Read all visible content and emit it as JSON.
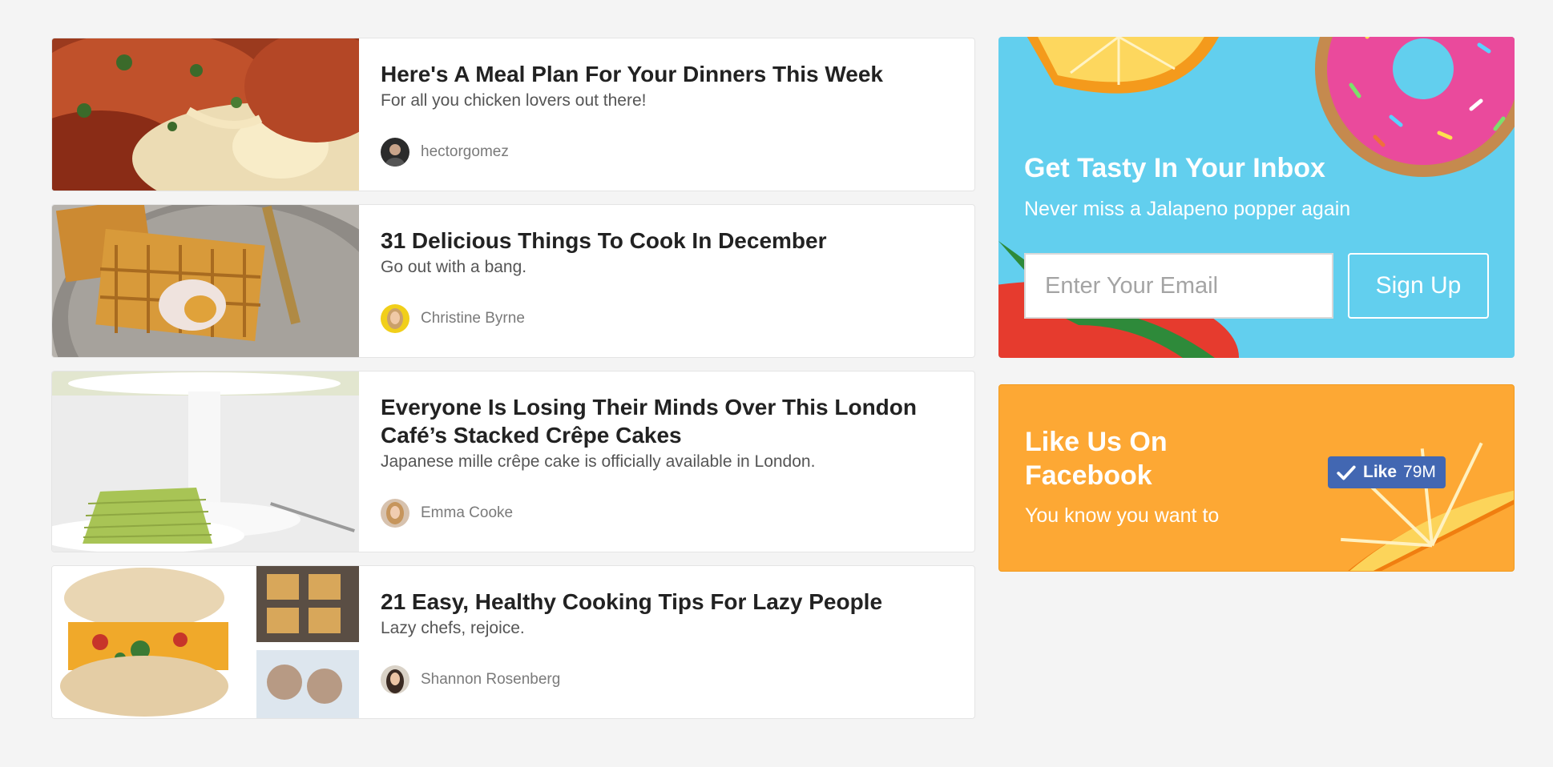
{
  "feed": {
    "items": [
      {
        "title": "Here's A Meal Plan For Your Dinners This Week",
        "description": "For all you chicken lovers out there!",
        "author": "hectorgomez",
        "image": "stuffed-chicken-photo"
      },
      {
        "title": "31 Delicious Things To Cook In December",
        "description": "Go out with a bang.",
        "author": "Christine Byrne",
        "image": "waffles-photo"
      },
      {
        "title": "Everyone Is Losing Their Minds Over This London Café’s Stacked Crêpe Cakes",
        "description": "Japanese mille crêpe cake is officially available in London.",
        "author": "Emma Cooke",
        "image": "crepe-cake-photo"
      },
      {
        "title": "21 Easy, Healthy Cooking Tips For Lazy People",
        "description": "Lazy chefs, rejoice.",
        "author": "Shannon Rosenberg",
        "image": "breakfast-sandwich-photo"
      }
    ]
  },
  "newsletter": {
    "title": "Get Tasty In Your Inbox",
    "subtitle": "Never miss a Jalapeno popper again",
    "email_placeholder": "Enter Your Email",
    "button_label": "Sign Up",
    "background_color": "#62cfee"
  },
  "facebook": {
    "title": "Like Us On Facebook",
    "subtitle": "You know you want to",
    "like_label": "Like",
    "like_count": "79M",
    "background_color": "#fda834",
    "button_color": "#4267b2"
  }
}
